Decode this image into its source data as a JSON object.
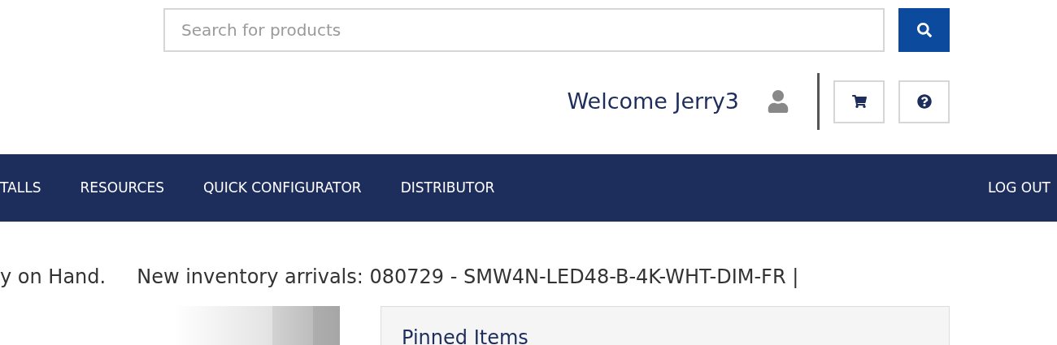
{
  "search": {
    "placeholder": "Search for products"
  },
  "welcome": "Welcome Jerry3",
  "nav": {
    "items": [
      {
        "label": "TALLS"
      },
      {
        "label": "RESOURCES"
      },
      {
        "label": "QUICK CONFIGURATOR"
      },
      {
        "label": "DISTRIBUTOR"
      }
    ],
    "logout": "LOG OUT"
  },
  "ticker": [
    "y on Hand.",
    "New inventory arrivals: 080729 - SMW4N-LED48-B-4K-WHT-DIM-FR |"
  ],
  "pinned": {
    "title": "Pinned Items"
  }
}
